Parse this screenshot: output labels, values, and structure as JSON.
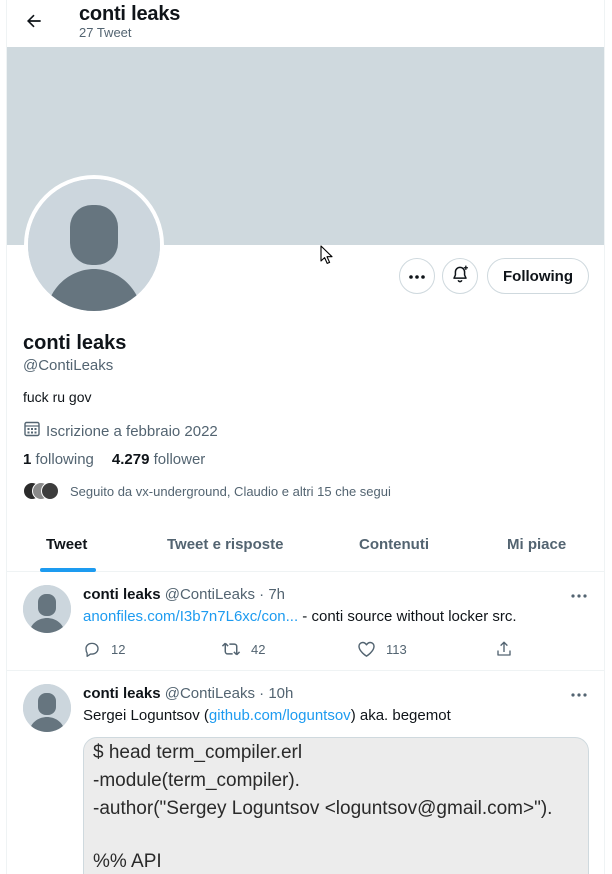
{
  "header": {
    "title": "conti leaks",
    "tweet_count": "27 Tweet"
  },
  "profile": {
    "name": "conti leaks",
    "handle": "@ContiLeaks",
    "bio": "fuck ru gov",
    "joined": "Iscrizione a febbraio 2022",
    "following_count": "1",
    "following_label": "following",
    "follower_count": "4.279",
    "follower_label": "follower",
    "mutuals": "Seguito da vx-underground, Claudio e altri 15 che segui",
    "follow_button": "Following"
  },
  "tabs": [
    {
      "label": "Tweet",
      "active": true
    },
    {
      "label": "Tweet e risposte",
      "active": false
    },
    {
      "label": "Contenuti",
      "active": false
    },
    {
      "label": "Mi piace",
      "active": false
    }
  ],
  "tweets": [
    {
      "name": "conti leaks",
      "meta": "@ContiLeaks · 7h",
      "link": "anonfiles.com/I3b7n7L6xc/con...",
      "text_after": " - conti source without locker src.",
      "replies": "12",
      "retweets": "42",
      "likes": "113"
    },
    {
      "name": "conti leaks",
      "meta": "@ContiLeaks · 10h",
      "text_before": "Sergei Loguntsov (",
      "link": "github.com/loguntsov",
      "text_after": ") aka. begemot",
      "code_lines": [
        "$ head term_compiler.erl",
        "-module(term_compiler).",
        "-author(\"Sergey Loguntsov <loguntsov@gmail.com>\").",
        "",
        "%% API"
      ]
    }
  ],
  "colors": {
    "accent": "#1d9bf0",
    "banner": "#cfd9de",
    "muted": "#536471"
  },
  "icons": [
    "back-arrow-icon",
    "more-icon",
    "notification-add-icon",
    "calendar-icon",
    "reply-icon",
    "retweet-icon",
    "like-icon",
    "share-icon"
  ]
}
